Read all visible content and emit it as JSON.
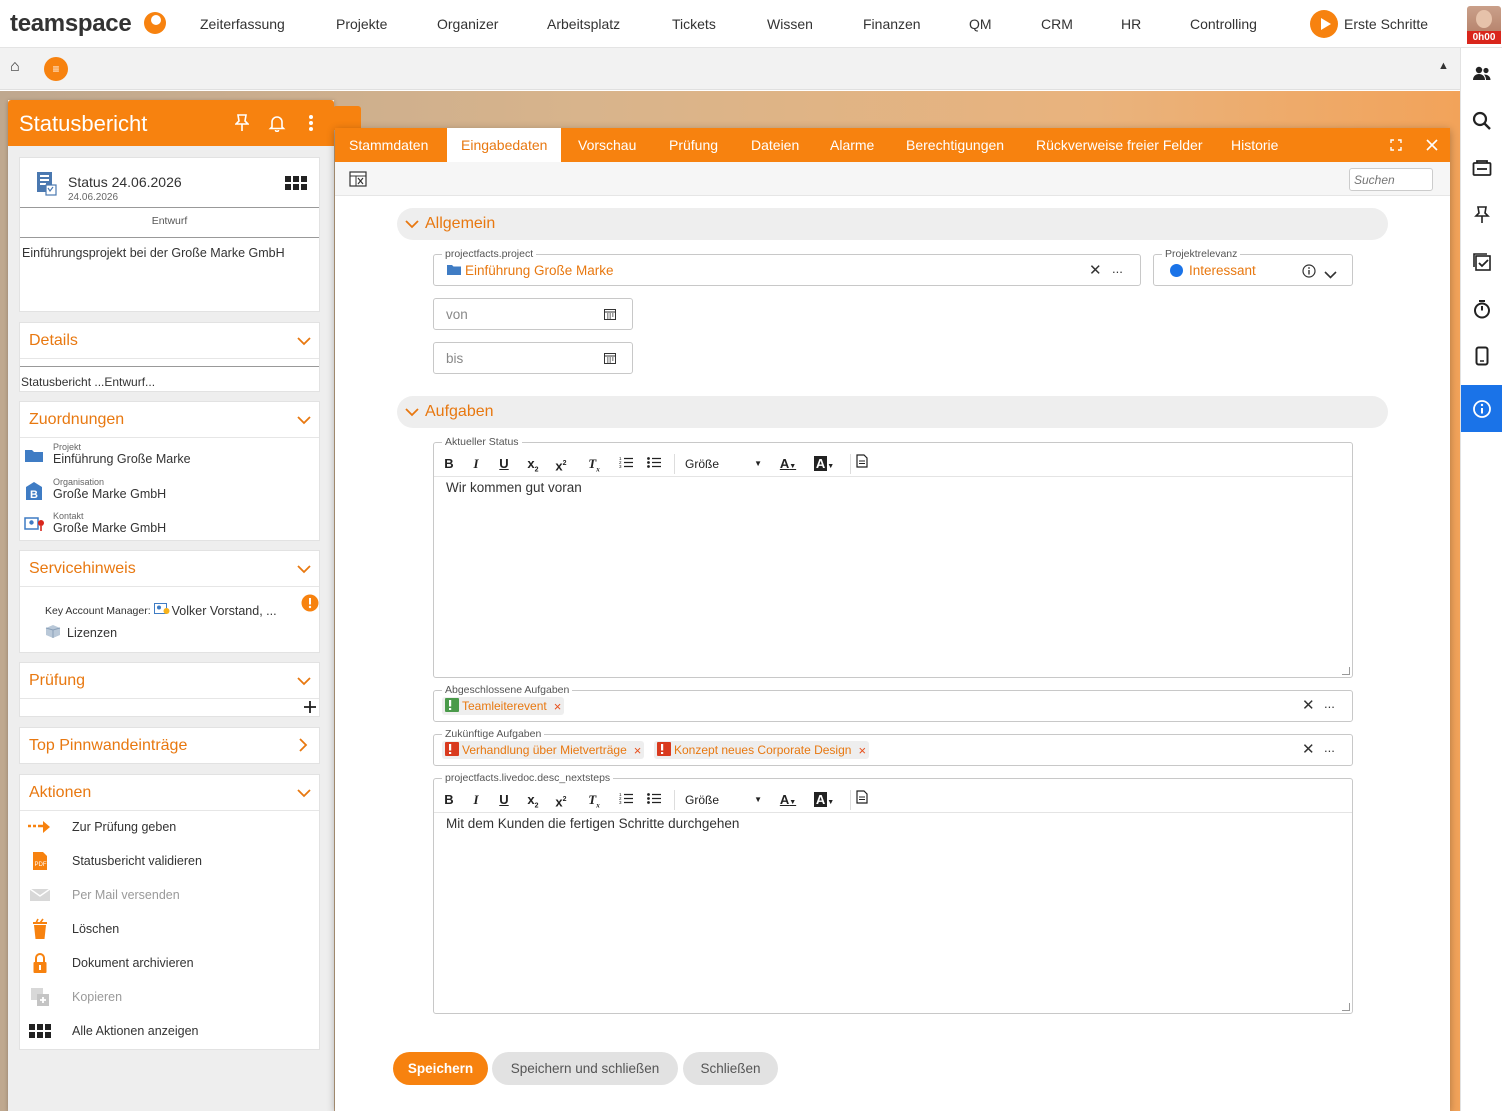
{
  "app": {
    "logo": "teamspace",
    "nav": [
      "Zeiterfassung",
      "Projekte",
      "Organizer",
      "Arbeitsplatz",
      "Tickets",
      "Wissen",
      "Finanzen",
      "QM",
      "CRM",
      "HR",
      "Controlling"
    ],
    "erste_schritte": "Erste Schritte",
    "user_badge": "0h00"
  },
  "left_panel": {
    "title": "Statusbericht",
    "document": {
      "title": "Status 24.06.2026",
      "date": "24.06.2026",
      "status": "Entwurf",
      "description": "Einführungsprojekt bei der Große Marke GmbH"
    },
    "details": {
      "title": "Details",
      "summary": "Statusbericht ...Entwurf..."
    },
    "zuordnungen": {
      "title": "Zuordnungen",
      "items": [
        {
          "label": "Projekt",
          "value": "Einführung Große Marke",
          "icon": "folder-icon"
        },
        {
          "label": "Organisation",
          "value": "Große Marke GmbH",
          "icon": "organisation-icon"
        },
        {
          "label": "Kontakt",
          "value": "Große Marke GmbH",
          "icon": "contact-icon"
        }
      ]
    },
    "servicehinweis": {
      "title": "Servicehinweis",
      "kam_label": "Key Account Manager:",
      "kam_value": "Volker Vorstand, ...",
      "lizenzen": "Lizenzen"
    },
    "pruefung": {
      "title": "Prüfung"
    },
    "pinnwand": {
      "title": "Top Pinnwandeinträge"
    },
    "aktionen": {
      "title": "Aktionen",
      "items": [
        {
          "label": "Zur Prüfung geben",
          "icon": "arrow-right-icon",
          "enabled": true
        },
        {
          "label": "Statusbericht validieren",
          "icon": "pdf-icon",
          "enabled": true
        },
        {
          "label": "Per Mail versenden",
          "icon": "mail-icon",
          "enabled": false
        },
        {
          "label": "Löschen",
          "icon": "trash-icon",
          "enabled": true
        },
        {
          "label": "Dokument archivieren",
          "icon": "lock-icon",
          "enabled": true
        },
        {
          "label": "Kopieren",
          "icon": "copy-icon",
          "enabled": false
        },
        {
          "label": "Alle Aktionen anzeigen",
          "icon": "grid-icon",
          "enabled": true
        }
      ]
    }
  },
  "dialog": {
    "tabs": [
      "Stammdaten",
      "Eingabedaten",
      "Vorschau",
      "Prüfung",
      "Dateien",
      "Alarme",
      "Berechtigungen",
      "Rückverweise freier Felder",
      "Historie"
    ],
    "active_tab": "Eingabedaten",
    "search_placeholder": "Suchen",
    "sections": {
      "allgemein": "Allgemein",
      "aufgaben": "Aufgaben"
    },
    "project_field": {
      "legend": "projectfacts.project",
      "value": "Einführung Große Marke"
    },
    "relevance_field": {
      "legend": "Projektrelevanz",
      "value": "Interessant",
      "color": "#1a73e8"
    },
    "von_placeholder": "von",
    "bis_placeholder": "bis",
    "status_field": {
      "legend": "Aktueller Status",
      "content": "Wir kommen gut voran"
    },
    "rte_size_label": "Größe",
    "completed_field": {
      "legend": "Abgeschlossene Aufgaben",
      "chips": [
        "Teamleiterevent"
      ]
    },
    "future_field": {
      "legend": "Zukünftige Aufgaben",
      "chips": [
        "Verhandlung über Mietverträge",
        "Konzept neues Corporate Design"
      ]
    },
    "nextsteps_field": {
      "legend": "projectfacts.livedoc.desc_nextsteps",
      "content": "Mit dem Kunden die fertigen Schritte durchgehen"
    },
    "buttons": {
      "save": "Speichern",
      "save_close": "Speichern und schließen",
      "close": "Schließen"
    }
  },
  "colors": {
    "accent": "#f7820f",
    "accent_text": "#e87810",
    "info_active": "#1a73e8"
  }
}
